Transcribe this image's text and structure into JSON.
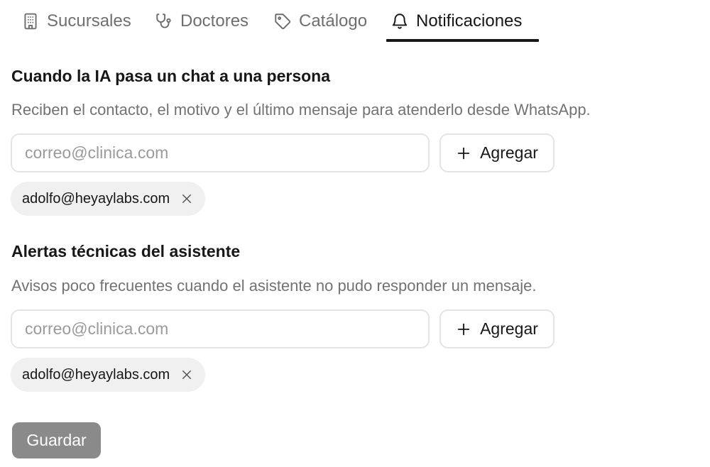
{
  "tabs": [
    {
      "label": "Sucursales",
      "icon": "building-icon",
      "active": false
    },
    {
      "label": "Doctores",
      "icon": "stethoscope-icon",
      "active": false
    },
    {
      "label": "Catálogo",
      "icon": "tag-icon",
      "active": false
    },
    {
      "label": "Notificaciones",
      "icon": "bell-icon",
      "active": true
    }
  ],
  "handoff": {
    "title": "Cuando la IA pasa un chat a una persona",
    "description": "Reciben el contacto, el motivo y el último mensaje para atenderlo desde WhatsApp.",
    "input_placeholder": "correo@clinica.com",
    "input_value": "",
    "add_label": "Agregar",
    "emails": [
      "adolfo@heyaylabs.com"
    ]
  },
  "alerts": {
    "title": "Alertas técnicas del asistente",
    "description": "Avisos poco frecuentes cuando el asistente no pudo responder un mensaje.",
    "input_placeholder": "correo@clinica.com",
    "input_value": "",
    "add_label": "Agregar",
    "emails": [
      "adolfo@heyaylabs.com"
    ]
  },
  "save_label": "Guardar",
  "colors": {
    "active_text": "#171717",
    "inactive_text": "#6f6f6f",
    "chip_background": "#f0f0f0",
    "save_button_disabled": "#8a8a8a"
  }
}
